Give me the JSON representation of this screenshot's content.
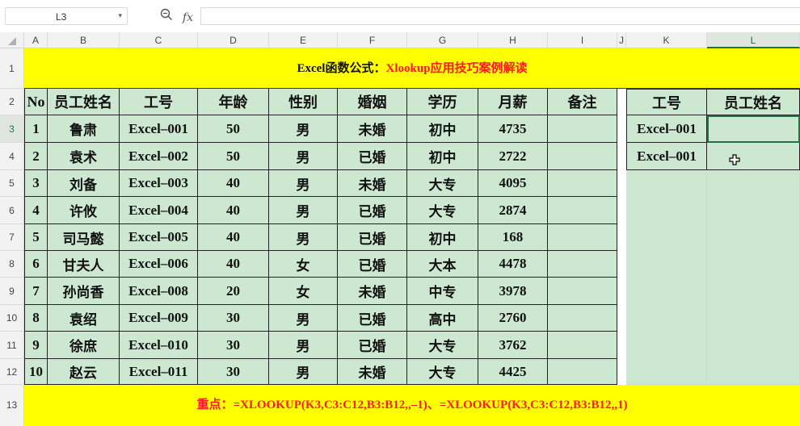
{
  "name_box": "L3",
  "formula_icons": [
    "zoom-icon",
    "fx-icon"
  ],
  "fx_label": "fx",
  "columns": [
    "A",
    "B",
    "C",
    "D",
    "E",
    "F",
    "G",
    "H",
    "I",
    "J",
    "K",
    "L"
  ],
  "rows": [
    "1",
    "2",
    "3",
    "4",
    "5",
    "6",
    "7",
    "8",
    "9",
    "10",
    "11",
    "12",
    "13"
  ],
  "title": {
    "black": "Excel函数公式：",
    "red": "Xlookup应用技巧案例解读"
  },
  "table_headers": [
    "No",
    "员工姓名",
    "工号",
    "年龄",
    "性别",
    "婚姻",
    "学历",
    "月薪",
    "备注"
  ],
  "table_rows": [
    [
      "1",
      "鲁肃",
      "Excel–001",
      "50",
      "男",
      "未婚",
      "初中",
      "4735",
      ""
    ],
    [
      "2",
      "袁术",
      "Excel–002",
      "50",
      "男",
      "已婚",
      "初中",
      "2722",
      ""
    ],
    [
      "3",
      "刘备",
      "Excel–003",
      "40",
      "男",
      "未婚",
      "大专",
      "4095",
      ""
    ],
    [
      "4",
      "许攸",
      "Excel–004",
      "40",
      "男",
      "已婚",
      "大专",
      "2874",
      ""
    ],
    [
      "5",
      "司马懿",
      "Excel–005",
      "40",
      "男",
      "已婚",
      "初中",
      "168",
      ""
    ],
    [
      "6",
      "甘夫人",
      "Excel–006",
      "40",
      "女",
      "已婚",
      "大本",
      "4478",
      ""
    ],
    [
      "7",
      "孙尚香",
      "Excel–008",
      "20",
      "女",
      "未婚",
      "中专",
      "3978",
      ""
    ],
    [
      "8",
      "袁绍",
      "Excel–009",
      "30",
      "男",
      "已婚",
      "高中",
      "2760",
      ""
    ],
    [
      "9",
      "徐庶",
      "Excel–010",
      "30",
      "男",
      "已婚",
      "大专",
      "3762",
      ""
    ],
    [
      "10",
      "赵云",
      "Excel–011",
      "30",
      "男",
      "未婚",
      "大专",
      "4425",
      ""
    ]
  ],
  "lookup_headers": [
    "工号",
    "员工姓名"
  ],
  "lookup_rows": [
    [
      "Excel–001",
      ""
    ],
    [
      "Excel–001",
      ""
    ]
  ],
  "footer": {
    "label": "重点：",
    "formula": "=XLOOKUP(K3,C3:C12,B3:B12,,–1)、=XLOOKUP(K3,C3:C12,B3:B12,,1)"
  },
  "colors": {
    "yellow": "#ffff00",
    "green_fill": "#cce8d1",
    "red_text": "#ff1a1a",
    "selection": "#217346"
  }
}
